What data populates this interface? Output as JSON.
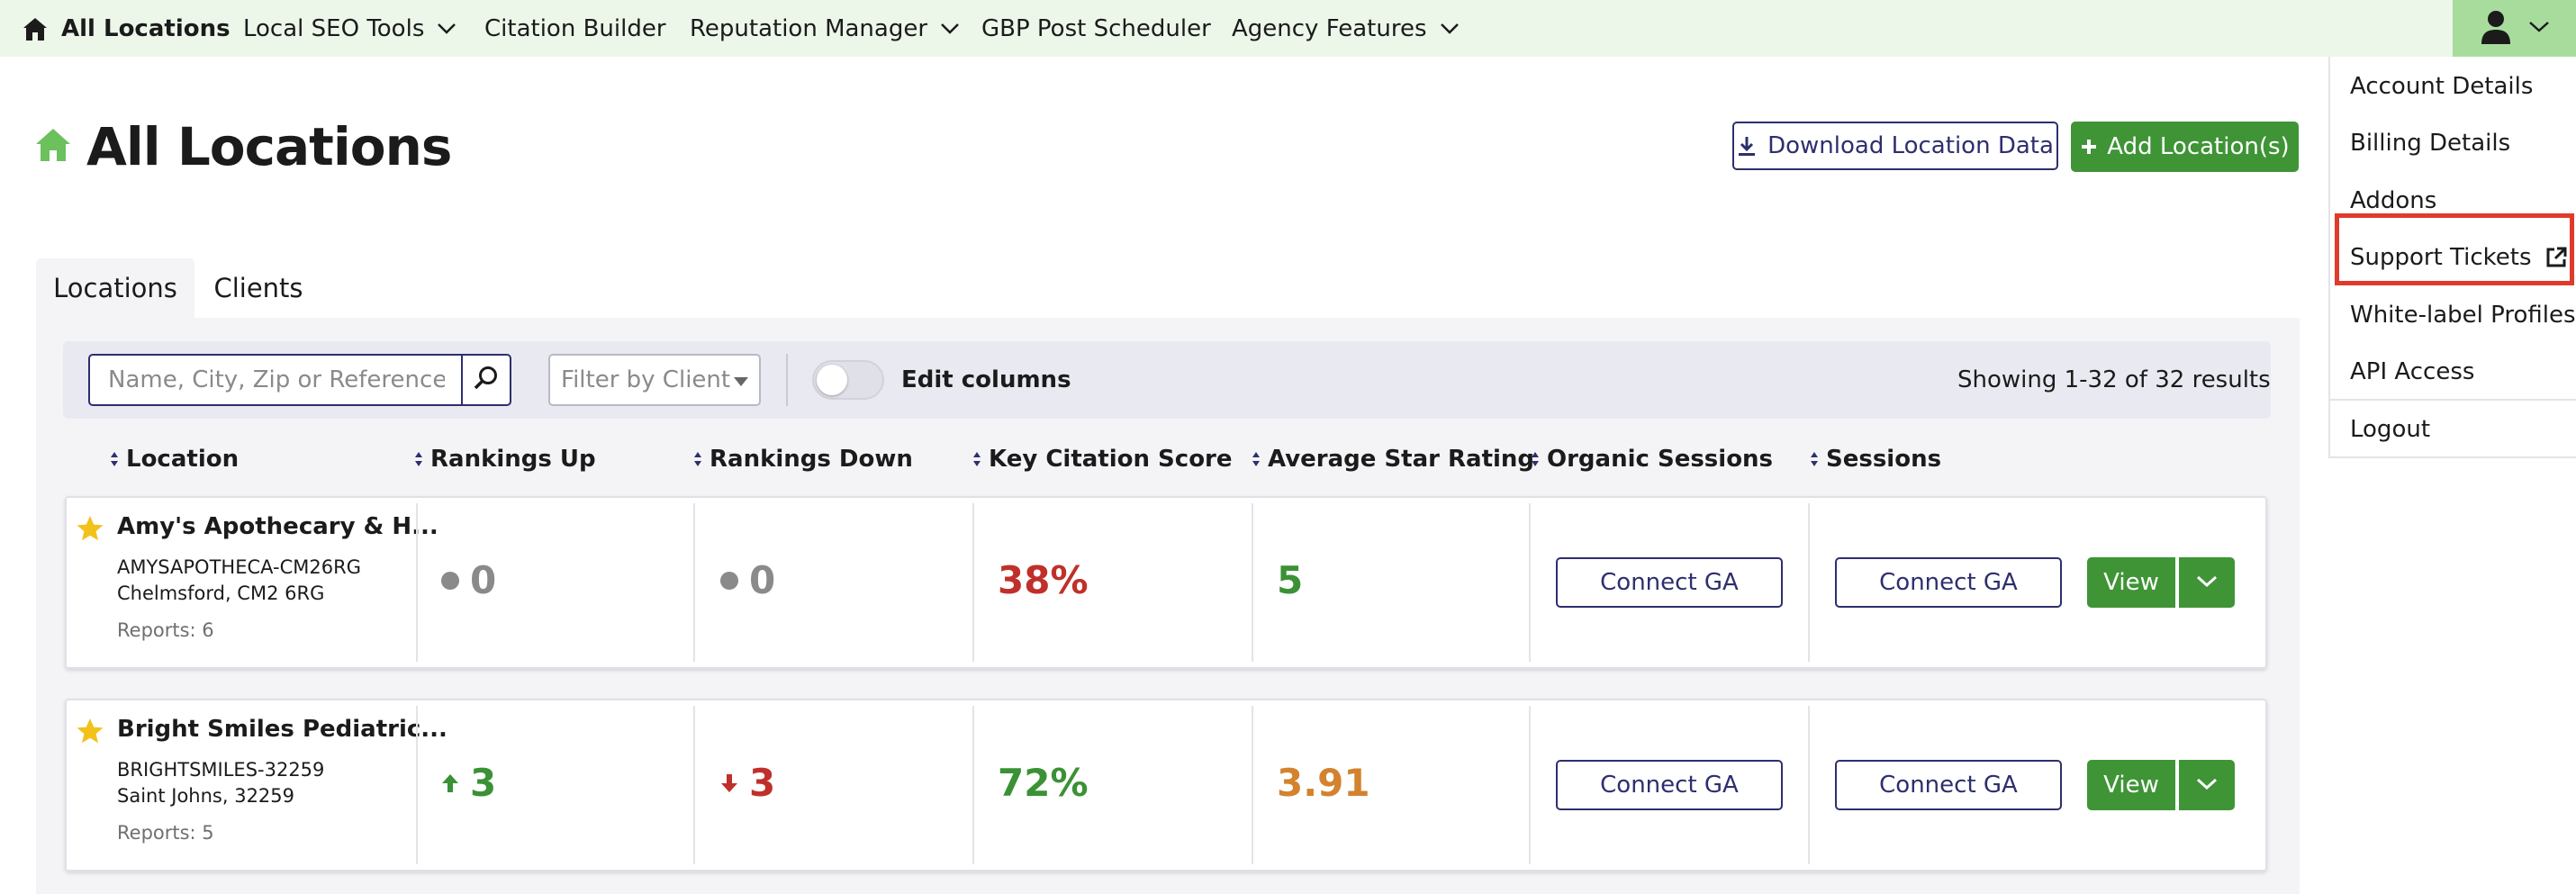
{
  "nav": {
    "home": "All Locations",
    "items": [
      {
        "label": "Local SEO Tools",
        "has_dropdown": true
      },
      {
        "label": "Citation Builder",
        "has_dropdown": false
      },
      {
        "label": "Reputation Manager",
        "has_dropdown": true
      },
      {
        "label": "GBP Post Scheduler",
        "has_dropdown": false
      },
      {
        "label": "Agency Features",
        "has_dropdown": true
      }
    ]
  },
  "user_menu": {
    "items": [
      "Account Details",
      "Billing Details",
      "Addons",
      "Support Tickets",
      "White-label Profiles",
      "API Access",
      "Logout"
    ],
    "highlighted": "Support Tickets"
  },
  "page": {
    "title": "All Locations",
    "download_label": "Download Location Data",
    "add_label": "Add Location(s)"
  },
  "tabs": [
    "Locations",
    "Clients"
  ],
  "toolbar": {
    "search_placeholder": "Name, City, Zip or Reference",
    "filter_placeholder": "Filter by Client",
    "edit_columns": "Edit columns",
    "results": "Showing 1-32 of 32 results"
  },
  "columns": [
    "Location",
    "Rankings Up",
    "Rankings Down",
    "Key Citation Score",
    "Average Star Rating",
    "Organic Sessions",
    "Sessions"
  ],
  "rows": [
    {
      "name": "Amy's Apothecary & H...",
      "reference": "AMYSAPOTHECA-CM26RG",
      "address": "Chelmsford, CM2 6RG",
      "reports": "Reports: 6",
      "rankings_up": "0",
      "rankings_up_trend": "neutral",
      "rankings_down": "0",
      "rankings_down_trend": "neutral",
      "citation_score": "38%",
      "star_rating": "5",
      "organic_sessions": "Connect GA",
      "sessions": "Connect GA",
      "view": "View"
    },
    {
      "name": "Bright Smiles Pediatric...",
      "reference": "BRIGHTSMILES-32259",
      "address": "Saint Johns, 32259",
      "reports": "Reports: 5",
      "rankings_up": "3",
      "rankings_up_trend": "up",
      "rankings_down": "3",
      "rankings_down_trend": "down",
      "citation_score": "72%",
      "star_rating": "3.91",
      "organic_sessions": "Connect GA",
      "sessions": "Connect GA",
      "view": "View"
    }
  ],
  "colors": {
    "nav_bg": "#ecf7ea",
    "user_btn_bg": "#a8dc9d",
    "green": "#3f9436",
    "navy": "#2d2f6e",
    "red": "#c0302a",
    "orange": "#d3822e",
    "metric_green": "#3b9135",
    "gray": "#8a8a8a",
    "highlight": "#e03a2b",
    "star": "#f2c21b"
  },
  "icons": {
    "home": "home-icon",
    "chevron": "chevron-down-icon",
    "user": "user-icon",
    "download": "download-icon",
    "plus": "plus-icon",
    "search": "search-icon",
    "sort": "sort-icon",
    "star": "star-icon",
    "external": "external-link-icon"
  }
}
